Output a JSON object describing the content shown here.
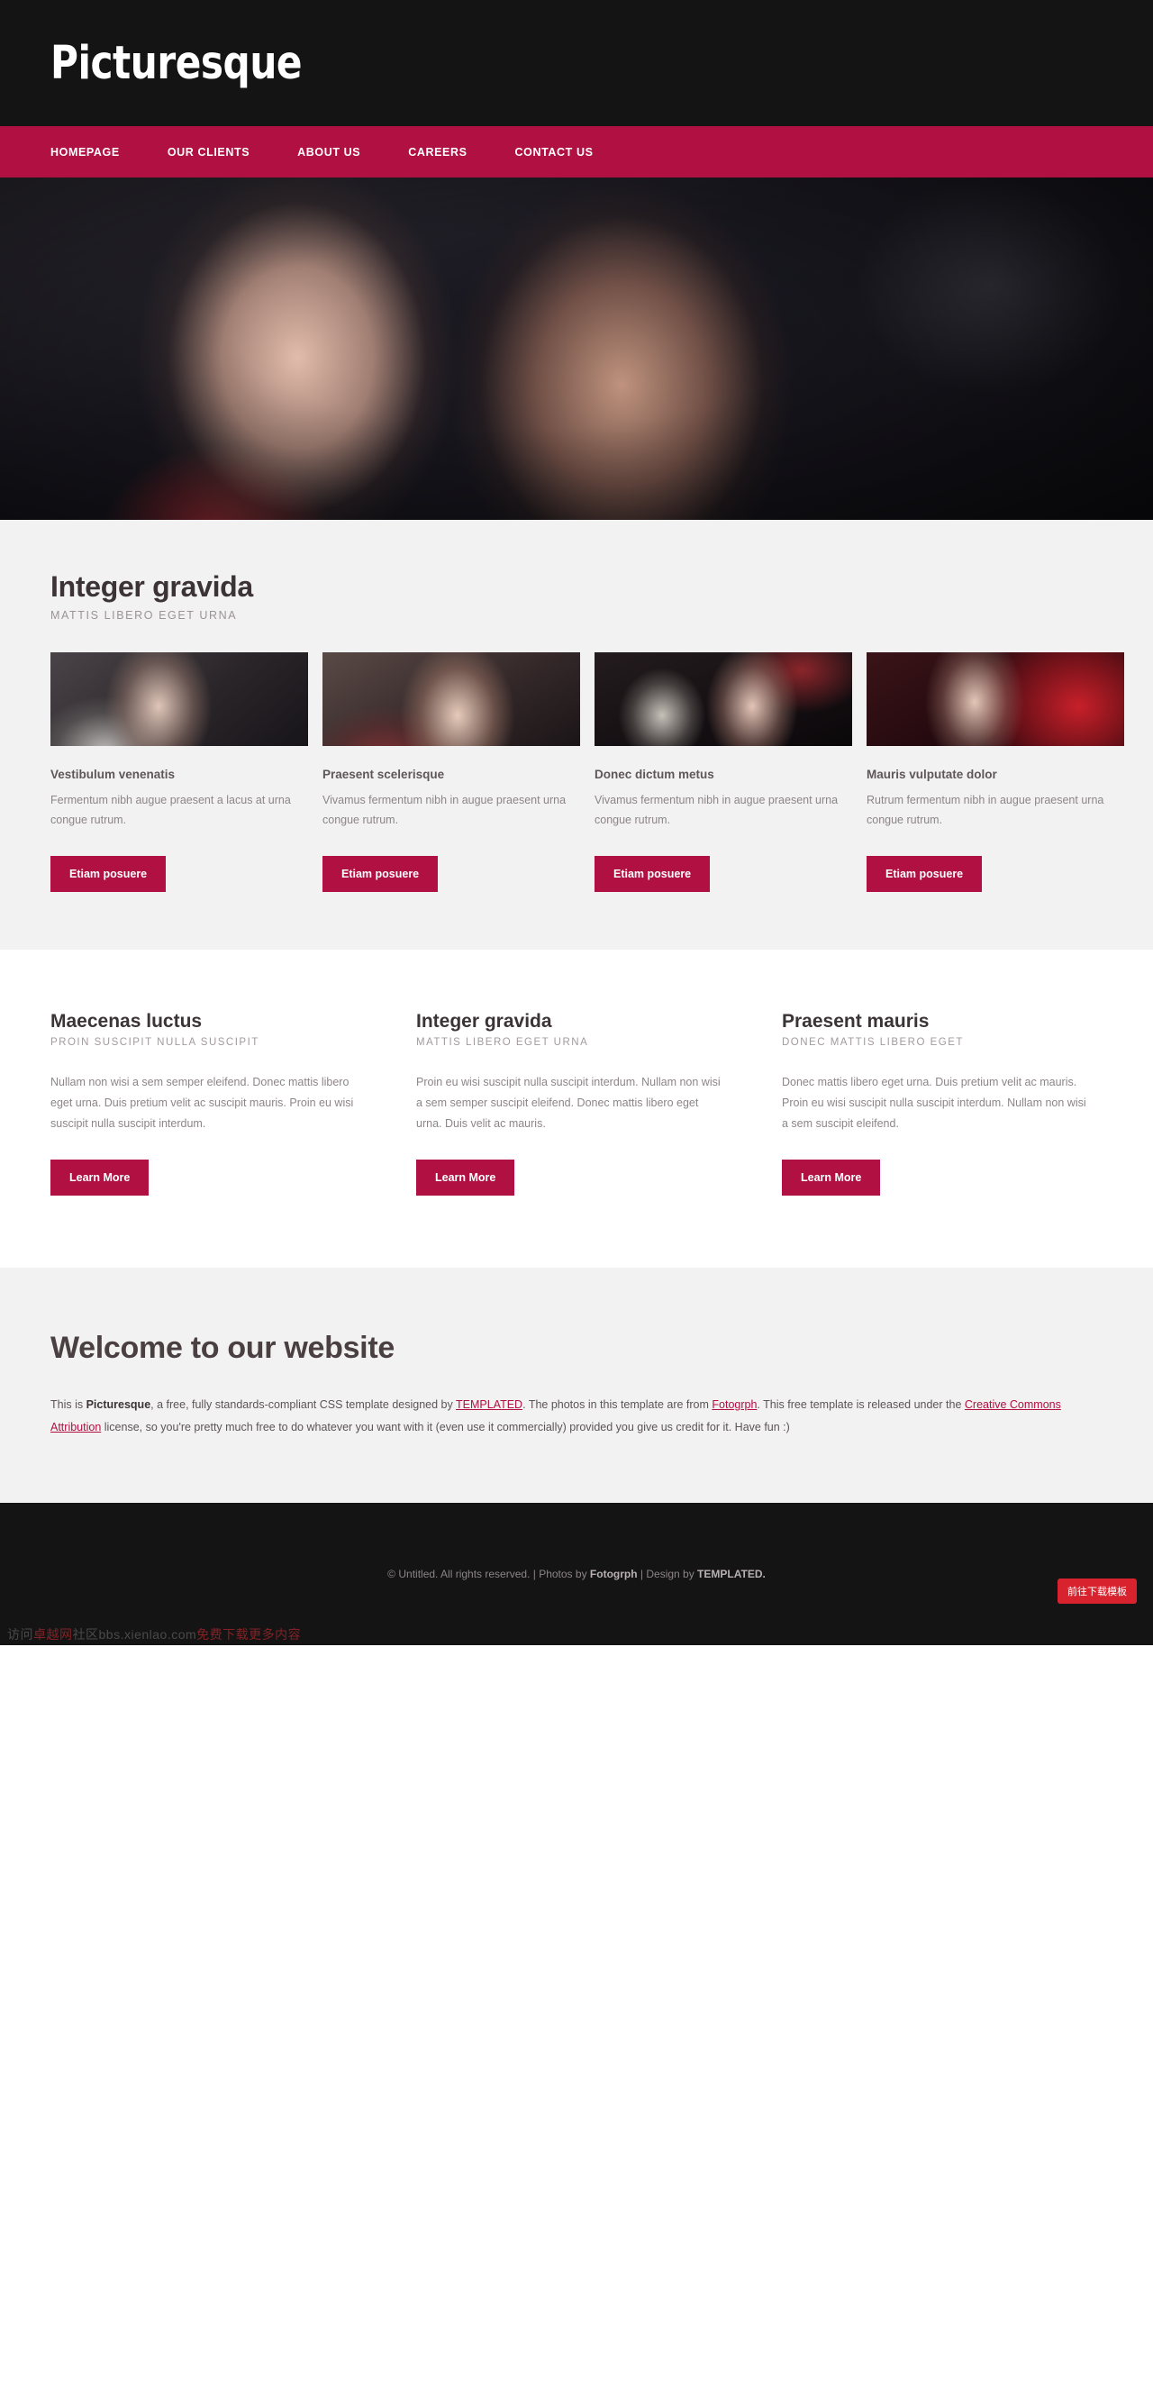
{
  "header": {
    "logo": "Picturesque"
  },
  "nav": {
    "items": [
      {
        "label": "HOMEPAGE"
      },
      {
        "label": "OUR CLIENTS"
      },
      {
        "label": "ABOUT US"
      },
      {
        "label": "CAREERS"
      },
      {
        "label": "CONTACT US"
      }
    ]
  },
  "banner": {
    "alt": "couple-portrait-photo"
  },
  "features": {
    "title": "Integer gravida",
    "subtitle": "MATTIS LIBERO EGET URNA",
    "cards": [
      {
        "image": "woman-with-scarf-photo",
        "title": "Vestibulum venenatis",
        "text": "Fermentum nibh augue praesent a lacus at urna congue rutrum.",
        "button": "Etiam posuere"
      },
      {
        "image": "woman-with-wavy-hair-photo",
        "title": "Praesent scelerisque",
        "text": "Vivamus fermentum nibh in augue praesent urna congue rutrum.",
        "button": "Etiam posuere"
      },
      {
        "image": "woman-with-skull-photo",
        "title": "Donec dictum metus",
        "text": "Vivamus fermentum nibh in augue praesent urna congue rutrum.",
        "button": "Etiam posuere"
      },
      {
        "image": "woman-on-red-background-photo",
        "title": "Mauris vulputate dolor",
        "text": "Rutrum fermentum nibh in augue praesent urna congue rutrum.",
        "button": "Etiam posuere"
      }
    ]
  },
  "columns": [
    {
      "title": "Maecenas luctus",
      "subtitle": "PROIN SUSCIPIT NULLA SUSCIPIT",
      "text": "Nullam non wisi a sem semper eleifend. Donec mattis libero eget urna. Duis pretium velit ac suscipit mauris. Proin eu wisi suscipit nulla suscipit interdum.",
      "button": "Learn More"
    },
    {
      "title": "Integer gravida",
      "subtitle": "MATTIS LIBERO EGET URNA",
      "text": "Proin eu wisi suscipit nulla suscipit interdum. Nullam non wisi a sem semper suscipit eleifend. Donec mattis libero eget urna. Duis velit ac mauris.",
      "button": "Learn More"
    },
    {
      "title": "Praesent mauris",
      "subtitle": "DONEC MATTIS LIBERO EGET",
      "text": "Donec mattis libero eget urna. Duis pretium velit ac mauris. Proin eu wisi suscipit nulla suscipit interdum. Nullam non wisi a sem suscipit eleifend.",
      "button": "Learn More"
    }
  ],
  "welcome": {
    "title": "Welcome to our website",
    "text_1": "This is ",
    "brand": "Picturesque",
    "text_2": ", a free, fully standards-compliant CSS template designed by ",
    "link_templated": "TEMPLATED",
    "text_3": ". The photos in this template are from ",
    "link_fotogrph": "Fotogrph",
    "text_4": ". This free template is released under the ",
    "link_cc": "Creative Commons Attribution",
    "text_5": " license, so you're pretty much free to do whatever you want with it (even use it commercially) provided you give us credit for it. Have fun :)"
  },
  "footer": {
    "copyright_1": "© Untitled. All rights reserved. | Photos by ",
    "photos_by": "Fotogrph",
    "copyright_2": " | Design by ",
    "design_by": "TEMPLATED.",
    "download_badge": "前往下载模板",
    "watermark_1": "访问",
    "watermark_2": "卓越网",
    "watermark_3": "社区bbs.xienlao.com",
    "watermark_4": "免费下载更多内容"
  },
  "colors": {
    "accent": "#B01042",
    "header_bg": "#141414",
    "section_bg": "#f2f2f2",
    "badge_red": "#d8232f"
  }
}
